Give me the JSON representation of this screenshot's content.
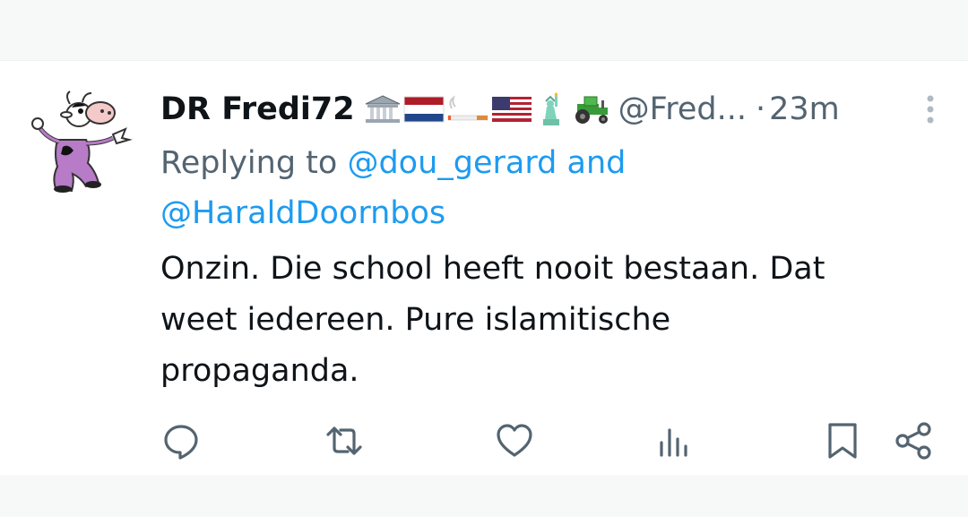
{
  "tweet": {
    "display_name": "DR Fredi72",
    "handle": "@Fred...",
    "separator": "·",
    "timestamp": "23m",
    "reply_prefix": "Replying to",
    "reply_mention_1": "@dou_gerard",
    "reply_joiner": "and",
    "reply_mention_2": "@HaraldDoornbos",
    "text": "Onzin. Die school heeft nooit bestaan. Dat\nweet iedereen. Pure islamitische\npropaganda.",
    "emojis": [
      "classical-building",
      "flag-netherlands",
      "cigarette",
      "flag-united-states",
      "statue-of-liberty",
      "tractor"
    ]
  },
  "colors": {
    "text_primary": "#0f1419",
    "text_secondary": "#536471",
    "link": "#1d9bf0",
    "background": "#ffffff",
    "page_background": "#f7f9f9"
  },
  "icons": {
    "actions": [
      "reply-icon",
      "retweet-icon",
      "like-icon",
      "views-icon",
      "bookmark-icon",
      "share-icon"
    ],
    "more": "more-vertical-icon"
  }
}
